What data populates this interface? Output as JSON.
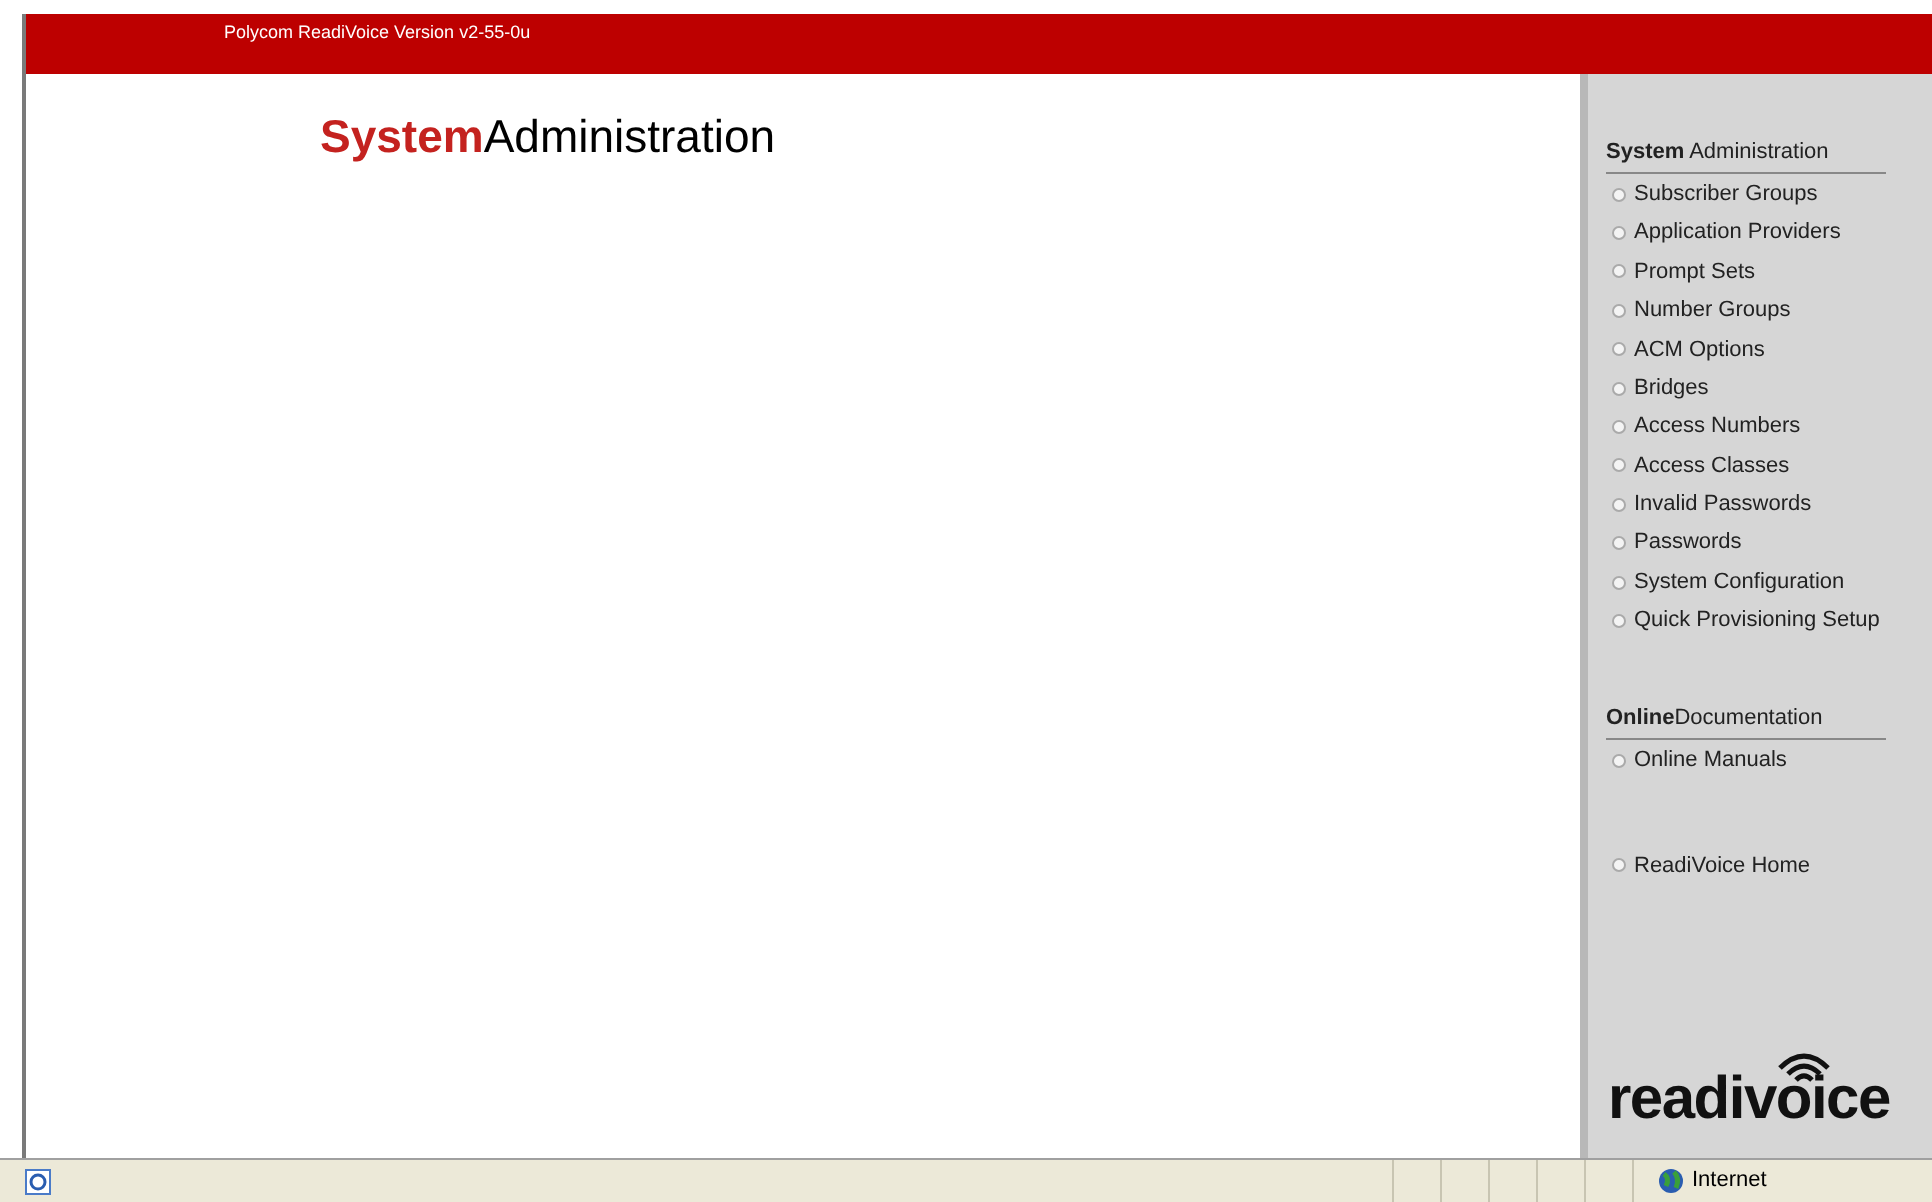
{
  "header": {
    "version": "Polycom ReadiVoice Version v2-55-0u"
  },
  "page_title": "**System**Administration",
  "sidebar": {
    "sections": [
      {
        "heading": "**System** Administration",
        "items": [
          "Subscriber Groups",
          "Application Providers",
          "Prompt Sets",
          "Number Groups",
          "ACM Options",
          "Bridges",
          "Access Numbers",
          "Access Classes",
          "Invalid Passwords",
          "Passwords",
          "System Configuration",
          "Quick Provisioning Setup"
        ]
      },
      {
        "heading": "**Online**Documentation",
        "items": [
          "Online Manuals"
        ]
      }
    ],
    "home_link": "ReadiVoice Home",
    "logo": "readivoice"
  },
  "status_bar": {
    "zone": "Internet"
  }
}
